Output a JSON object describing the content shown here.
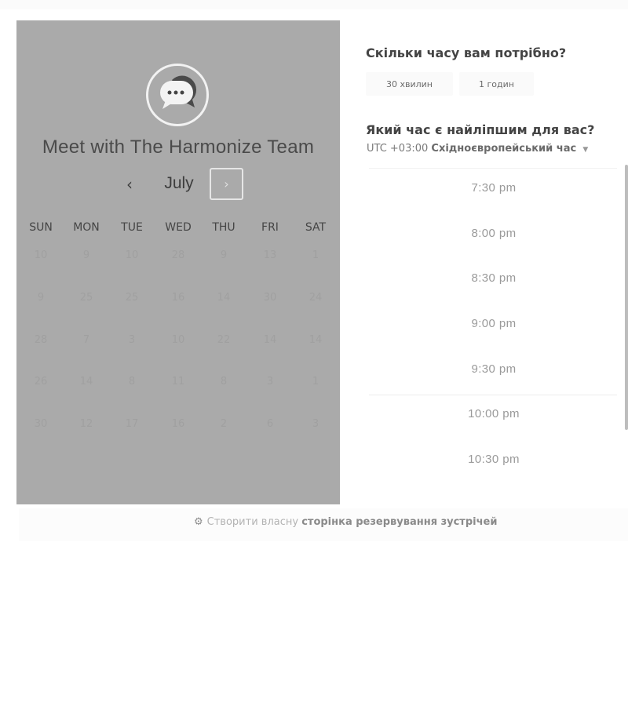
{
  "calendar": {
    "title": "Meet with The Harmonize Team",
    "month": "July",
    "prev_icon": "‹",
    "next_icon": "›",
    "weekdays": [
      "SUN",
      "MON",
      "TUE",
      "WED",
      "THU",
      "FRI",
      "SAT"
    ],
    "weeks": [
      [
        "10",
        "9",
        "10",
        "28",
        "9",
        "13",
        "1"
      ],
      [
        "9",
        "25",
        "25",
        "16",
        "14",
        "30",
        "24"
      ],
      [
        "28",
        "7",
        "3",
        "10",
        "22",
        "14",
        "14"
      ],
      [
        "26",
        "14",
        "8",
        "11",
        "8",
        "3",
        "1"
      ],
      [
        "30",
        "12",
        "17",
        "16",
        "2",
        "6",
        "3"
      ]
    ]
  },
  "duration": {
    "question": "Скільки часу вам потрібно?",
    "options": [
      "30 хвилин",
      "1 годин"
    ]
  },
  "time": {
    "question": "Який час є найліпшим для вас?",
    "timezone_prefix": "UTC +03:00",
    "timezone_name": "Східноєвропейський час",
    "slots": [
      "7:30 pm",
      "8:00 pm",
      "8:30 pm",
      "9:00 pm",
      "9:30 pm",
      "10:00 pm",
      "10:30 pm"
    ]
  },
  "footer": {
    "prefix": "Створити власну",
    "link": "сторінка резервування зустрічей"
  },
  "colors": {
    "panel": "#aaaaaa",
    "background": "#ffffff"
  }
}
